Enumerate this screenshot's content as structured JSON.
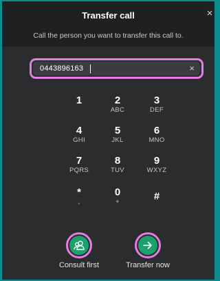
{
  "dialog": {
    "title": "Transfer call",
    "subtitle": "Call the person you want to transfer this call to.",
    "close_glyph": "×"
  },
  "search": {
    "value": "0443896163",
    "clear_glyph": "×"
  },
  "keypad": [
    {
      "digit": "1",
      "letters": ""
    },
    {
      "digit": "2",
      "letters": "ABC"
    },
    {
      "digit": "3",
      "letters": "DEF"
    },
    {
      "digit": "4",
      "letters": "GHI"
    },
    {
      "digit": "5",
      "letters": "JKL"
    },
    {
      "digit": "6",
      "letters": "MNO"
    },
    {
      "digit": "7",
      "letters": "PQRS"
    },
    {
      "digit": "8",
      "letters": "TUV"
    },
    {
      "digit": "9",
      "letters": "WXYZ"
    },
    {
      "digit": "*",
      "letters": ","
    },
    {
      "digit": "0",
      "letters": "+"
    },
    {
      "digit": "#",
      "letters": ""
    }
  ],
  "actions": {
    "consult_label": "Consult first",
    "transfer_label": "Transfer now"
  },
  "colors": {
    "accent_green": "#1ca06d",
    "highlight_pink": "#e87ce6",
    "frame_teal": "#0e8d8e"
  },
  "icons": {
    "consult": "people-icon",
    "transfer": "arrow-right-icon",
    "close": "close-icon",
    "clear": "clear-icon"
  }
}
